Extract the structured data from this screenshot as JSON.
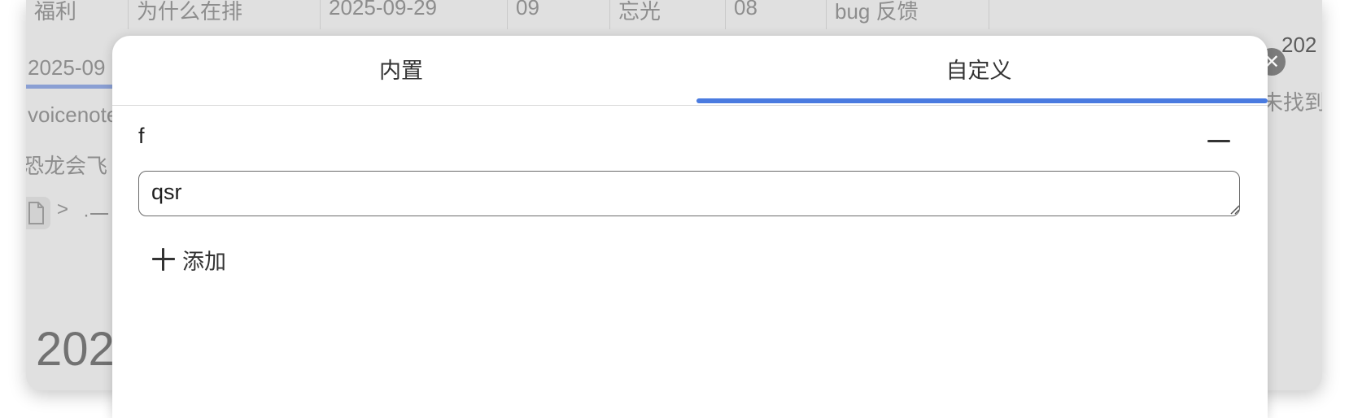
{
  "background": {
    "table_row": [
      "福利",
      "为什么在排",
      "2025-09-29",
      "09",
      "忘光",
      "08",
      "bug 反馈"
    ],
    "right_top_text": "202",
    "date_text": "2025-09",
    "right_status_text": "未找到",
    "voicenote_text": "voicenote",
    "dino_text": "恐龙会飞",
    "breadcrumb_sep": ">",
    "breadcrumb_item": "·一",
    "big_year_text": "202"
  },
  "tabs": [
    {
      "label": "内置",
      "active": false
    },
    {
      "label": "自定义",
      "active": true
    }
  ],
  "custom_item": {
    "key": "f",
    "value": "qsr"
  },
  "add_button": {
    "label": "添加"
  },
  "colors": {
    "accent": "#4a7be0",
    "text": "#333333",
    "background_dim": "#ececec"
  }
}
